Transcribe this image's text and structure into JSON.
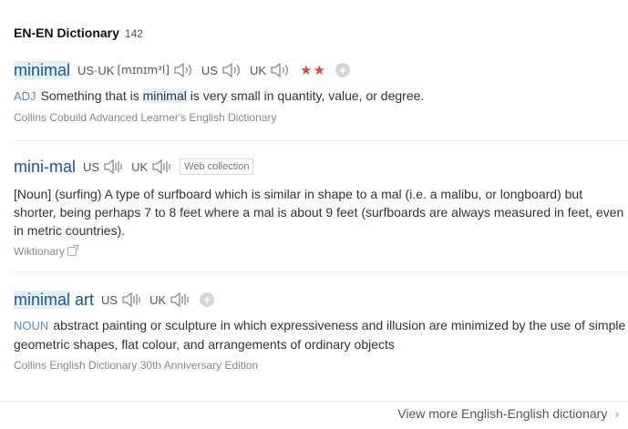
{
  "header": {
    "title": "EN-EN Dictionary",
    "count": "142"
  },
  "entries": [
    {
      "word": "minimal",
      "pron_us_uk_label": "US·UK",
      "phonetic": "[mɪnɪm³l]",
      "us_label": "US",
      "uk_label": "UK",
      "stars": "★★",
      "pos": "ADJ",
      "def_before": "Something that is ",
      "def_highlight": "minimal",
      "def_after": " is very small in quantity, value, or degree.",
      "source": "Collins Cobuild Advanced Learner's English Dictionary"
    },
    {
      "word": "mini-mal",
      "us_label": "US",
      "uk_label": "UK",
      "tag": "Web collection",
      "definition": "[Noun] (surfing) A type of surfboard which is similar in shape to a mal (i.e. a malibu, or longboard) but shorter, being perhaps 7 to 8 feet where a mal is about 9 feet (surfboards are always measured in feet, even in metric countries).",
      "source": "Wiktionary"
    },
    {
      "word_highlight": "minimal",
      "word_rest": " art",
      "us_label": "US",
      "uk_label": "UK",
      "pos": "NOUN",
      "definition": "abstract painting or sculpture in which expressiveness and illusion are minimized by the use of simple geometric shapes, flat colour, and arrangements of ordinary objects",
      "source": "Collins English Dictionary 30th Anniversary Edition"
    }
  ],
  "footer": {
    "more_link": "View more English-English dictionary"
  },
  "colors": {
    "word": "#1a55a8",
    "highlight": "#e3f0fb",
    "star": "#e0443a",
    "pos": "#5a8bc2"
  },
  "icons": {
    "speaker": "speaker-icon",
    "add": "plus-icon",
    "external": "external-link-icon",
    "chevron": "chevron-right-icon"
  }
}
